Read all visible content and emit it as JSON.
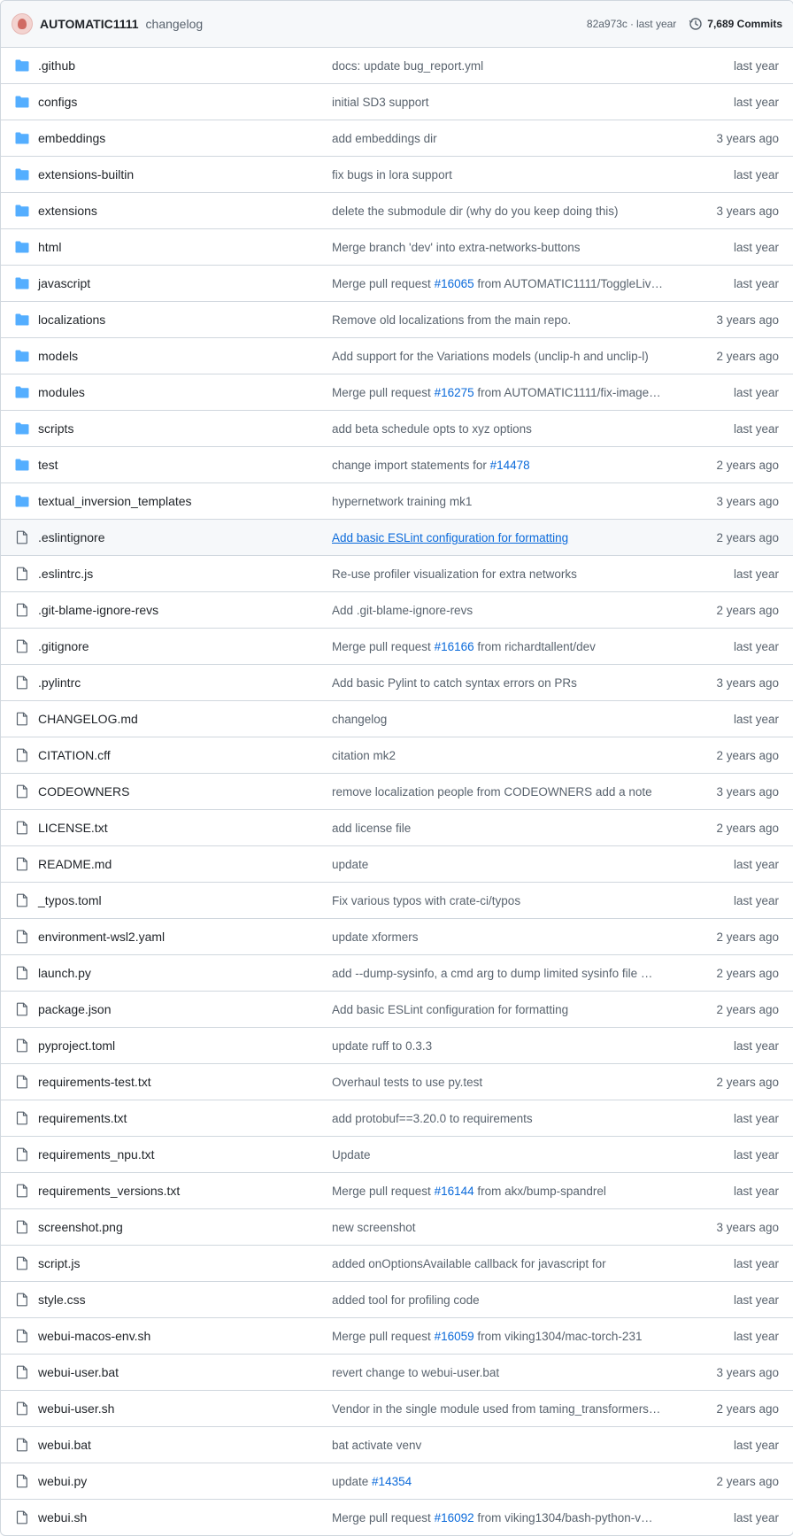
{
  "header": {
    "author": "AUTOMATIC1111",
    "message": "changelog",
    "sha": "82a973c",
    "separator": "·",
    "time": "last year",
    "commits": "7,689 Commits"
  },
  "colors": {
    "folder": "#54aeff",
    "file": "#59636e",
    "link": "#0969da"
  },
  "rows": [
    {
      "type": "dir",
      "name": ".github",
      "msg": "docs: update bug_report.yml",
      "age": "last year"
    },
    {
      "type": "dir",
      "name": "configs",
      "msg": "initial SD3 support",
      "age": "last year"
    },
    {
      "type": "dir",
      "name": "embeddings",
      "msg": "add embeddings dir",
      "age": "3 years ago"
    },
    {
      "type": "dir",
      "name": "extensions-builtin",
      "msg": "fix bugs in lora support",
      "age": "last year"
    },
    {
      "type": "dir",
      "name": "extensions",
      "msg": "delete the submodule dir (why do you keep doing this)",
      "age": "3 years ago"
    },
    {
      "type": "dir",
      "name": "html",
      "msg": "Merge branch 'dev' into extra-networks-buttons",
      "age": "last year"
    },
    {
      "type": "dir",
      "name": "javascript",
      "msg": "Merge pull request ",
      "pr": "#16065",
      "msg2": " from AUTOMATIC1111/ToggleLiv…",
      "age": "last year"
    },
    {
      "type": "dir",
      "name": "localizations",
      "msg": "Remove old localizations from the main repo.",
      "age": "3 years ago"
    },
    {
      "type": "dir",
      "name": "models",
      "msg": "Add support for the Variations models (unclip-h and unclip-l)",
      "age": "2 years ago"
    },
    {
      "type": "dir",
      "name": "modules",
      "msg": "Merge pull request ",
      "pr": "#16275",
      "msg2": " from AUTOMATIC1111/fix-image…",
      "age": "last year"
    },
    {
      "type": "dir",
      "name": "scripts",
      "msg": "add beta schedule opts to xyz options",
      "age": "last year"
    },
    {
      "type": "dir",
      "name": "test",
      "msg": "change import statements for ",
      "pr": "#14478",
      "msg2": "",
      "age": "2 years ago"
    },
    {
      "type": "dir",
      "name": "textual_inversion_templates",
      "msg": "hypernetwork training mk1",
      "age": "3 years ago"
    },
    {
      "type": "file",
      "name": ".eslintignore",
      "msg": "Add basic ESLint configuration for formatting",
      "age": "2 years ago",
      "highlight": true,
      "link": true
    },
    {
      "type": "file",
      "name": ".eslintrc.js",
      "msg": "Re-use profiler visualization for extra networks",
      "age": "last year"
    },
    {
      "type": "file",
      "name": ".git-blame-ignore-revs",
      "msg": "Add .git-blame-ignore-revs",
      "age": "2 years ago"
    },
    {
      "type": "file",
      "name": ".gitignore",
      "msg": "Merge pull request ",
      "pr": "#16166",
      "msg2": " from richardtallent/dev",
      "age": "last year"
    },
    {
      "type": "file",
      "name": ".pylintrc",
      "msg": "Add basic Pylint to catch syntax errors on PRs",
      "age": "3 years ago"
    },
    {
      "type": "file",
      "name": "CHANGELOG.md",
      "msg": "changelog",
      "age": "last year"
    },
    {
      "type": "file",
      "name": "CITATION.cff",
      "msg": "citation mk2",
      "age": "2 years ago"
    },
    {
      "type": "file",
      "name": "CODEOWNERS",
      "msg": "remove localization people from CODEOWNERS add a note",
      "age": "3 years ago"
    },
    {
      "type": "file",
      "name": "LICENSE.txt",
      "msg": "add license file",
      "age": "2 years ago"
    },
    {
      "type": "file",
      "name": "README.md",
      "msg": "update",
      "age": "last year"
    },
    {
      "type": "file",
      "name": "_typos.toml",
      "msg": "Fix various typos with crate-ci/typos",
      "age": "last year"
    },
    {
      "type": "file",
      "name": "environment-wsl2.yaml",
      "msg": "update xformers",
      "age": "2 years ago"
    },
    {
      "type": "file",
      "name": "launch.py",
      "msg": "add --dump-sysinfo, a cmd arg to dump limited sysinfo file …",
      "age": "2 years ago"
    },
    {
      "type": "file",
      "name": "package.json",
      "msg": "Add basic ESLint configuration for formatting",
      "age": "2 years ago"
    },
    {
      "type": "file",
      "name": "pyproject.toml",
      "msg": "update ruff to 0.3.3",
      "age": "last year"
    },
    {
      "type": "file",
      "name": "requirements-test.txt",
      "msg": "Overhaul tests to use py.test",
      "age": "2 years ago"
    },
    {
      "type": "file",
      "name": "requirements.txt",
      "msg": "add protobuf==3.20.0 to requirements",
      "age": "last year"
    },
    {
      "type": "file",
      "name": "requirements_npu.txt",
      "msg": "Update",
      "age": "last year"
    },
    {
      "type": "file",
      "name": "requirements_versions.txt",
      "msg": "Merge pull request ",
      "pr": "#16144",
      "msg2": " from akx/bump-spandrel",
      "age": "last year"
    },
    {
      "type": "file",
      "name": "screenshot.png",
      "msg": "new screenshot",
      "age": "3 years ago"
    },
    {
      "type": "file",
      "name": "script.js",
      "msg": "added onOptionsAvailable callback for javascript for",
      "age": "last year"
    },
    {
      "type": "file",
      "name": "style.css",
      "msg": "added tool for profiling code",
      "age": "last year"
    },
    {
      "type": "file",
      "name": "webui-macos-env.sh",
      "msg": "Merge pull request ",
      "pr": "#16059",
      "msg2": " from viking1304/mac-torch-231",
      "age": "last year"
    },
    {
      "type": "file",
      "name": "webui-user.bat",
      "msg": "revert change to webui-user.bat",
      "age": "3 years ago"
    },
    {
      "type": "file",
      "name": "webui-user.sh",
      "msg": "Vendor in the single module used from taming_transformers…",
      "age": "2 years ago"
    },
    {
      "type": "file",
      "name": "webui.bat",
      "msg": "bat activate venv",
      "age": "last year"
    },
    {
      "type": "file",
      "name": "webui.py",
      "msg": "update ",
      "pr": "#14354",
      "msg2": "",
      "age": "2 years ago"
    },
    {
      "type": "file",
      "name": "webui.sh",
      "msg": "Merge pull request ",
      "pr": "#16092",
      "msg2": " from viking1304/bash-python-v…",
      "age": "last year"
    }
  ]
}
